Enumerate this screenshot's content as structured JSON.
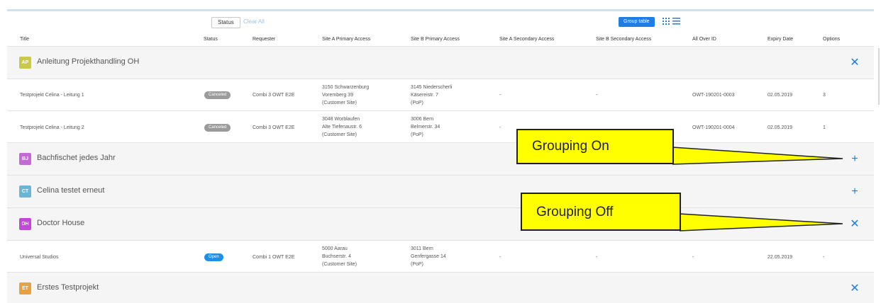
{
  "toolbar": {
    "status_filter": "Status",
    "clear_all": "Clear All",
    "group_table": "Group table"
  },
  "columns": [
    "Title",
    "Status",
    "Requester",
    "Site A Primary Access",
    "Site B Primary Access",
    "Site A Secondary Access",
    "Site B Secondary Access",
    "All Over ID",
    "Expiry Date",
    "Options"
  ],
  "groups": [
    {
      "initials": "AP",
      "title": "Anleitung Projekthandling OH",
      "toggle": "✕",
      "color": "#c8c84a"
    },
    {
      "initials": "BJ",
      "title": "Bachfischet jedes Jahr",
      "toggle": "+",
      "color": "#c46ad6"
    },
    {
      "initials": "CT",
      "title": "Celina testet erneut",
      "toggle": "+",
      "color": "#6ab4d6"
    },
    {
      "initials": "DH",
      "title": "Doctor House",
      "toggle": "✕",
      "color": "#c04ad6"
    },
    {
      "initials": "ET",
      "title": "Erstes Testprojekt",
      "toggle": "✕",
      "color": "#e8a040"
    }
  ],
  "rows": [
    {
      "title": "Testprojekt Celina - Leitung 1",
      "status": "Canceled",
      "requester": "Combi 3 OWT E2E",
      "site_a": [
        "3150 Schwarzenburg",
        "Voremberg 39",
        "(Customer Site)"
      ],
      "site_b": [
        "3145 Niederscherli",
        "Käsereistr. 7",
        "(PoP)"
      ],
      "site_a_sec": "-",
      "site_b_sec": "-",
      "all_over_id": "OWT-190201-0003",
      "expiry": "02.05.2019",
      "options": "3"
    },
    {
      "title": "Testprojekt Celina - Leitung 2",
      "status": "Canceled",
      "requester": "Combi 3 OWT E2E",
      "site_a": [
        "3048 Worblaufen",
        "Alte Tiefenaustr. 6",
        "(Customer Site)"
      ],
      "site_b": [
        "3006 Bern",
        "Belmerstr. 34",
        "(PoP)"
      ],
      "site_a_sec": "-",
      "site_b_sec": "",
      "all_over_id": "OWT-190201-0004",
      "expiry": "02.05.2019",
      "options": "1"
    },
    {
      "title": "Universal Studios",
      "status": "Open",
      "requester": "Combi 1 OWT E2E",
      "site_a": [
        "5000 Aarau",
        "Buchserstr. 4",
        "(Customer Site)"
      ],
      "site_b": [
        "3011 Bern",
        "Genfergasse 14",
        "(PoP)"
      ],
      "site_a_sec": "-",
      "site_b_sec": "-",
      "all_over_id": "-",
      "expiry": "22.05.2019",
      "options": "-"
    }
  ],
  "callouts": {
    "grouping_on": "Grouping On",
    "grouping_off": "Grouping Off"
  },
  "colors": {
    "accent": "#1f7de3",
    "callout": "#ffff00"
  }
}
